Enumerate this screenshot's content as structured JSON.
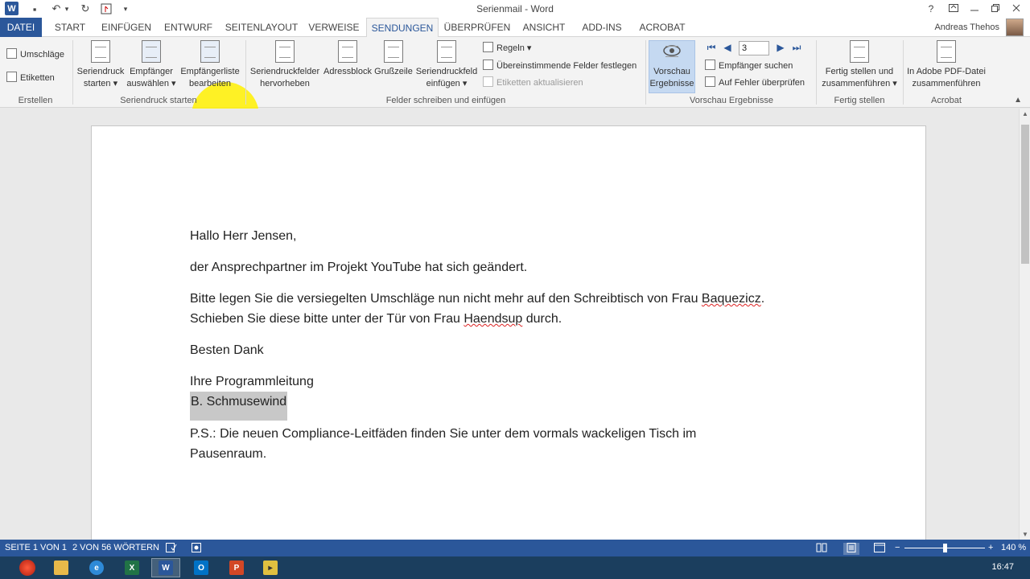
{
  "window": {
    "title": "Serienmail - Word",
    "help": "?",
    "user": "Andreas Thehos"
  },
  "quick_access": {
    "word": "W",
    "save": "▪",
    "undo": "↶",
    "redo": "↻",
    "more": "▾"
  },
  "tabs": [
    "DATEI",
    "START",
    "EINFÜGEN",
    "ENTWURF",
    "SEITENLAYOUT",
    "VERWEISE",
    "SENDUNGEN",
    "ÜBERPRÜFEN",
    "ANSICHT",
    "ADD-INS",
    "ACROBAT"
  ],
  "ribbon": {
    "erstellen": {
      "umschlaege": "Umschläge",
      "etiketten": "Etiketten",
      "label": "Erstellen"
    },
    "seriendruck": {
      "starten_1": "Seriendruck",
      "starten_2": "starten ▾",
      "empfaenger_1": "Empfänger",
      "empfaenger_2": "auswählen ▾",
      "liste_1": "Empfängerliste",
      "liste_2": "bearbeiten",
      "label": "Seriendruck starten"
    },
    "felder": {
      "hervorheben_1": "Seriendruckfelder",
      "hervorheben_2": "hervorheben",
      "adressblock": "Adressblock",
      "grusszeile": "Grußzeile",
      "einfuegen_1": "Seriendruckfeld",
      "einfuegen_2": "einfügen ▾",
      "regeln": "Regeln ▾",
      "uebereinstimmende": "Übereinstimmende Felder festlegen",
      "aktualisieren": "Etiketten aktualisieren",
      "label": "Felder schreiben und einfügen"
    },
    "vorschau": {
      "btn_1": "Vorschau",
      "btn_2": "Ergebnisse",
      "record": "3",
      "suchen": "Empfänger suchen",
      "fehler": "Auf Fehler überprüfen",
      "label": "Vorschau Ergebnisse"
    },
    "fertig": {
      "btn_1": "Fertig stellen und",
      "btn_2": "zusammenführen ▾",
      "label": "Fertig stellen"
    },
    "acrobat": {
      "btn_1": "In Adobe PDF-Datei",
      "btn_2": "zusammenführen",
      "label": "Acrobat"
    }
  },
  "document": {
    "greeting": "Hallo Herr Jensen,",
    "line1": "der Ansprechpartner im Projekt YouTube hat sich geändert.",
    "line2a": "Bitte legen Sie die versiegelten Umschläge nun nicht mehr auf den Schreibtisch von Frau ",
    "line2b": "Baquezicz",
    "line2c": ".",
    "line3a": "Schieben Sie diese bitte unter der Tür von Frau ",
    "line3b": "Haendsup",
    "line3c": " durch.",
    "thanks": "Besten Dank",
    "closing": "Ihre Programmleitung",
    "signature": "B. Schmusewind",
    "ps1": "P.S.: Die neuen Compliance-Leitfäden finden Sie unter dem vormals wackeligen Tisch im",
    "ps2": "Pausenraum."
  },
  "status": {
    "page": "SEITE 1 VON 1",
    "words": "2 VON 56 WÖRTERN",
    "zoom": "140 %"
  },
  "taskbar": {
    "time": "16:47"
  },
  "colors": {
    "accent": "#2b579a",
    "highlight": "#fff000",
    "taskbar": "#1b3e5e"
  }
}
